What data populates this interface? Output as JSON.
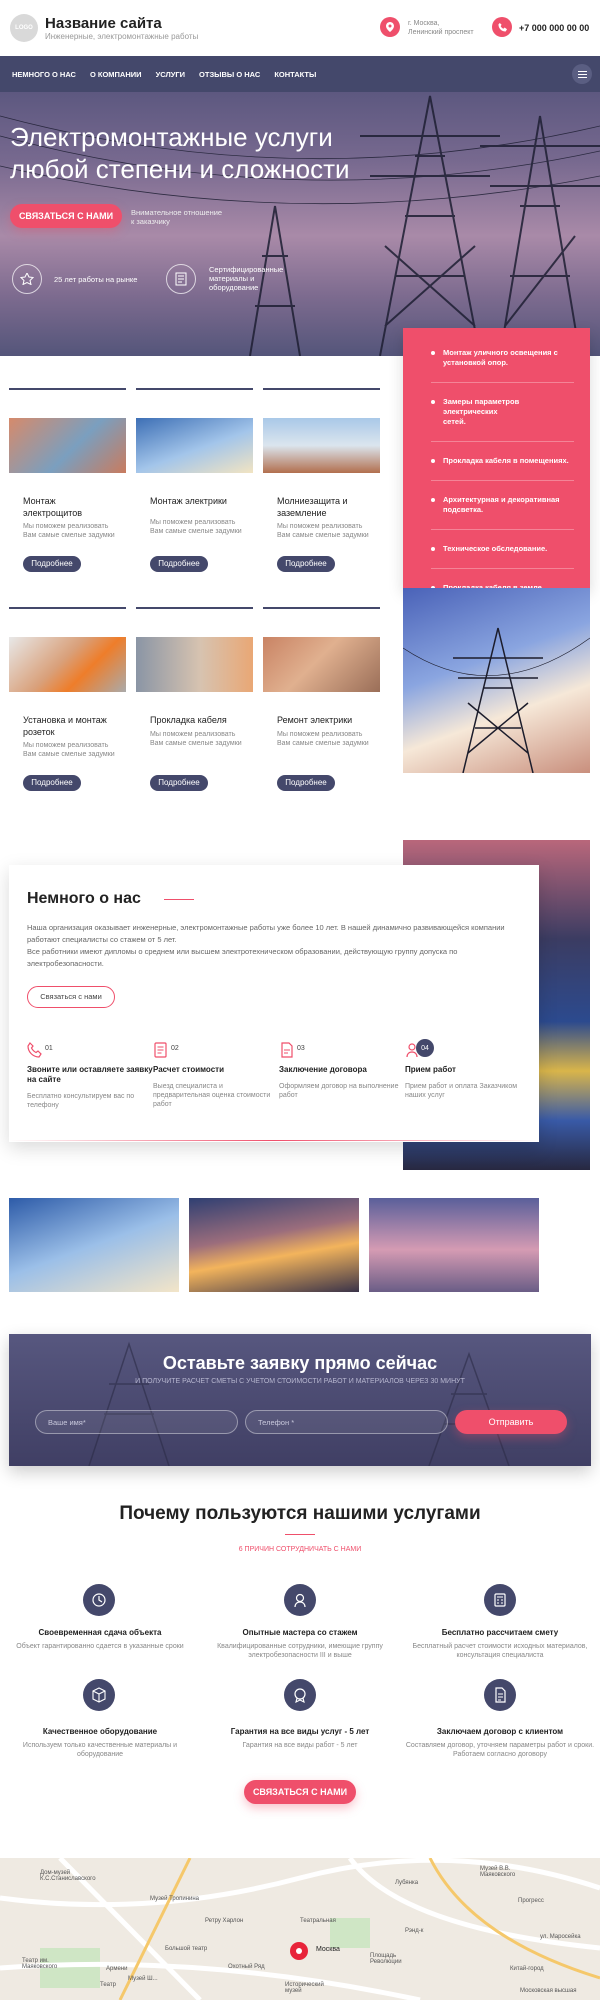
{
  "header": {
    "logo_text": "LOGO",
    "site_name": "Название сайта",
    "tagline": "Инженерные, электромонтажные работы",
    "address_line1": "г. Москва,",
    "address_line2": "Ленинский проспект",
    "phone": "+7 000 000 00 00"
  },
  "nav": {
    "items": [
      "НЕМНОГО О НАС",
      "О КОМПАНИИ",
      "УСЛУГИ",
      "ОТЗЫВЫ О НАС",
      "КОНТАКТЫ"
    ]
  },
  "hero": {
    "title_line1": "Электромонтажные услуги",
    "title_line2": "любой степени и сложности",
    "cta_label": "СВЯЗАТЬСЯ С НАМИ",
    "note_line1": "Внимательное отношение",
    "note_line2": "к заказчику",
    "feature1": "25 лет работы на рынке",
    "feature2_line1": "Сертифицированные",
    "feature2_line2": "материалы и",
    "feature2_line3": "оборудование"
  },
  "services": [
    {
      "title_line1": "Монтаж",
      "title_line2": "электрощитов",
      "desc_line1": "Мы поможем реализовать",
      "desc_line2": "Вам самые смелые задумки",
      "button": "Подробнее"
    },
    {
      "title_line1": "Монтаж электрики",
      "title_line2": "",
      "desc_line1": "Мы поможем реализовать",
      "desc_line2": "Вам самые смелые задумки",
      "button": "Подробнее"
    },
    {
      "title_line1": "Молниезащита и",
      "title_line2": "заземление",
      "desc_line1": "Мы поможем реализовать",
      "desc_line2": "Вам самые смелые задумки",
      "button": "Подробнее"
    },
    {
      "title_line1": "Установка и монтаж",
      "title_line2": "розеток",
      "desc_line1": "Мы поможем реализовать",
      "desc_line2": "Вам самые смелые задумки",
      "button": "Подробнее"
    },
    {
      "title_line1": "Прокладка кабеля",
      "title_line2": "",
      "desc_line1": "Мы поможем реализовать",
      "desc_line2": "Вам самые смелые задумки",
      "button": "Подробнее"
    },
    {
      "title_line1": "Ремонт электрики",
      "title_line2": "",
      "desc_line1": "Мы поможем реализовать",
      "desc_line2": "Вам самые смелые задумки",
      "button": "Подробнее"
    }
  ],
  "service_list": [
    {
      "line1": "Монтаж уличного освещения с",
      "line2": "установкой опор."
    },
    {
      "line1": "Замеры параметров электрических",
      "line2": "сетей."
    },
    {
      "line1": "Прокладка кабеля в помещениях.",
      "line2": ""
    },
    {
      "line1": "Архитектурная и декоративная",
      "line2": "подсветка."
    },
    {
      "line1": "Техническое обследование.",
      "line2": ""
    },
    {
      "line1": "Прокладка кабеля в земле.",
      "line2": ""
    }
  ],
  "about": {
    "title": "Немного о нас",
    "p1": "Наша организация оказывает инженерные, электромонтажные работы уже более 10 лет. В нашей динамично развивающейся компании",
    "p2": "работают специалисты со стажем от 5 лет.",
    "p3": "Все работники имеют дипломы о среднем или высшем электротехническом образовании, действующую группу допуска по",
    "p4": "электробезопасности.",
    "button": "Связаться с нами",
    "steps": [
      {
        "num": "01",
        "title_line1": "Звоните или оставляете заявку",
        "title_line2": "на сайте",
        "desc_line1": "Бесплатно консультируем вас по",
        "desc_line2": "телефону"
      },
      {
        "num": "02",
        "title_line1": "Расчет стоимости",
        "title_line2": "",
        "desc_line1": "Выезд специалиста и",
        "desc_line2": "предварительная оценка стоимости",
        "desc_line3": "работ"
      },
      {
        "num": "03",
        "title_line1": "Заключение договора",
        "title_line2": "",
        "desc_line1": "Оформляем договор на выполнение",
        "desc_line2": "работ"
      },
      {
        "num": "04",
        "title_line1": "Прием работ",
        "title_line2": "",
        "desc_line1": "Прием работ и оплата Заказчиком",
        "desc_line2": "наших услуг"
      }
    ]
  },
  "request": {
    "title": "Оставьте заявку прямо сейчас",
    "subtitle": "И ПОЛУЧИТЕ РАСЧЕТ СМЕТЫ С УЧЕТОМ СТОИМОСТИ РАБОТ И МАТЕРИАЛОВ ЧЕРЕЗ 30 МИНУТ",
    "name_placeholder": "Ваше имя*",
    "phone_placeholder": "Телефон *",
    "submit": "Отправить"
  },
  "why": {
    "title": "Почему пользуются нашими услугами",
    "subtitle": "6 ПРИЧИН СОТРУДНИЧАТЬ С НАМИ",
    "items": [
      {
        "title": "Своевременная сдача объекта",
        "desc_line1": "Объект гарантированно сдается в указанные сроки",
        "desc_line2": "",
        "icon": "clock-icon"
      },
      {
        "title": "Опытные мастера со стажем",
        "desc_line1": "Квалифицированные сотрудники, имеющие группу",
        "desc_line2": "электробезопасности III и выше",
        "icon": "worker-icon"
      },
      {
        "title": "Бесплатно рассчитаем смету",
        "desc_line1": "Бесплатный расчет стоимости исходных материалов,",
        "desc_line2": "консультация специалиста",
        "icon": "calculator-icon"
      },
      {
        "title": "Качественное оборудование",
        "desc_line1": "Используем только качественные материалы и",
        "desc_line2": "оборудование",
        "icon": "box-icon"
      },
      {
        "title": "Гарантия на все виды услуг - 5 лет",
        "desc_line1": "Гарантия на все виды работ - 5 лет",
        "desc_line2": "",
        "icon": "badge-icon"
      },
      {
        "title": "Заключаем договор с клиентом",
        "desc_line1": "Составляем договор, уточняем параметры работ и сроки.",
        "desc_line2": "Работаем согласно договору",
        "icon": "contract-icon"
      }
    ],
    "cta": "СВЯЗАТЬСЯ С НАМИ"
  },
  "map": {
    "labels": [
      "Дом-музей К.С.Станиславского",
      "Музей Тропинина",
      "Театральная",
      "Площадь Революции",
      "Москва",
      "Охотный Ряд",
      "Исторический музей",
      "Большой театр",
      "Китай-город",
      "Прогресс",
      "ул. Маросейка",
      "Рэнд-к",
      "Театр им. Маяковского",
      "Музей В.В. Маяковского",
      "Московская высшая",
      "Лубянка",
      "Ретру Харлон",
      "Армени",
      "Музей Ш...",
      "Театр"
    ]
  },
  "colors": {
    "accent": "#ef4f6b",
    "dark": "#44486b",
    "nav_bg": "#44486b"
  }
}
